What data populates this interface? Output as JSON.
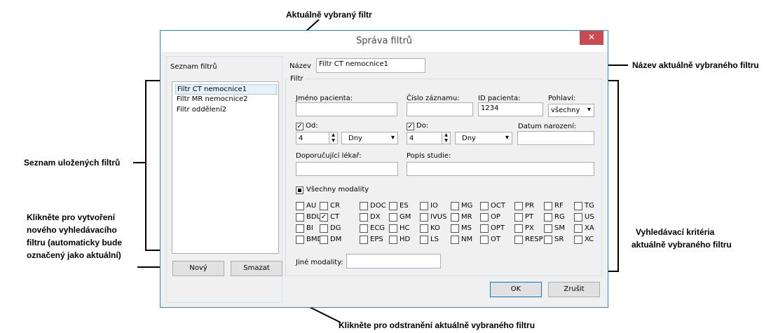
{
  "annotations": {
    "top": "Aktuálně vybraný filtr",
    "name": "Název aktuálně vybraného filtru",
    "list": "Seznam uložených filtrů",
    "new": [
      "Klikněte pro vytvoření",
      "nového vyhledávacího",
      "filtru (automaticky bude",
      "označený jako aktuální)"
    ],
    "criteria": [
      "Vyhledávací kritéria",
      "aktuálně vybraného filtru"
    ],
    "delete": "Klikněte pro odstranění aktuálně vybraného filtru"
  },
  "dialog": {
    "title": "Správa filtrů",
    "close": "✕",
    "list_label": "Seznam filtrů",
    "filters": [
      "Filtr CT nemocnice1",
      "Filtr MR nemocnice2",
      "Filtr oddělení2"
    ],
    "selected_index": 0,
    "new_button": "Nový",
    "delete_button": "Smazat",
    "name_label": "Název",
    "name_value": "Filtr CT nemocnice1",
    "filter_group": "Filtr",
    "patient_name_label": "Jméno pacienta:",
    "patient_name_value": "",
    "record_number_label": "Číslo záznamu:",
    "record_number_value": "",
    "patient_id_label": "ID pacienta:",
    "patient_id_value": "1234",
    "sex_label": "Pohlaví:",
    "sex_value": "všechny",
    "from_label": "Od:",
    "from_checked": true,
    "from_value": "4",
    "from_unit": "Dny",
    "to_label": "Do:",
    "to_checked": true,
    "to_value": "4",
    "to_unit": "Dny",
    "birth_date_label": "Datum narození:",
    "birth_date_value": "",
    "referring_label": "Doporučující lékař:",
    "referring_value": "",
    "study_desc_label": "Popis studie:",
    "study_desc_value": "",
    "all_modalities_label": "Všechny modality",
    "modalities": [
      [
        "AU",
        "CR",
        "DOC",
        "ES",
        "IO",
        "MG",
        "OCT",
        "PR",
        "RF",
        "TG"
      ],
      [
        "BDUS",
        "CT",
        "DX",
        "GM",
        "IVUS",
        "MR",
        "OP",
        "PT",
        "RG",
        "US"
      ],
      [
        "BI",
        "DG",
        "ECG",
        "HC",
        "KO",
        "MS",
        "OPT",
        "PX",
        "SM",
        "XA"
      ],
      [
        "BMD",
        "DM",
        "EPS",
        "HD",
        "LS",
        "NM",
        "OT",
        "RESP",
        "SR",
        "XC"
      ]
    ],
    "checked_modalities": [
      "CT"
    ],
    "other_modalities_label": "Jiné modality:",
    "other_modalities_value": "",
    "ok_button": "OK",
    "cancel_button": "Zrušit"
  }
}
